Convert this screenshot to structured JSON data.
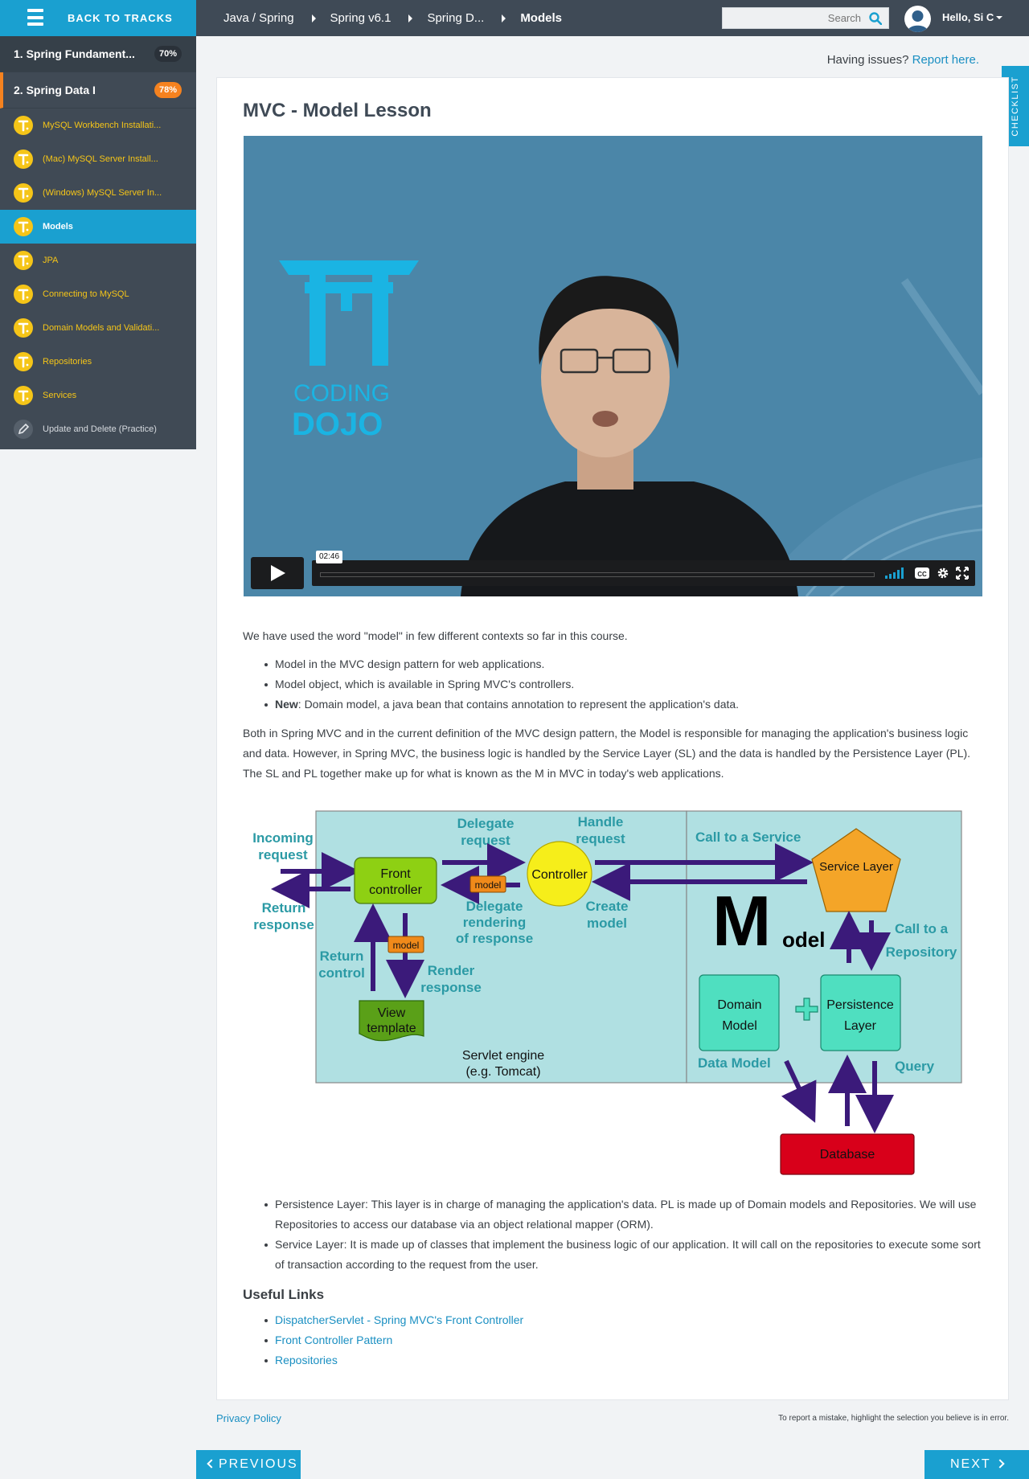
{
  "header": {
    "back_label": "BACK TO TRACKS",
    "breadcrumbs": [
      "Java / Spring",
      "Spring v6.1",
      "Spring D...",
      "Models"
    ],
    "search_placeholder": "Search",
    "user_greeting": "Hello, Si C"
  },
  "sidebar": {
    "sections": [
      {
        "label": "1. Spring Fundament...",
        "progress": "70%"
      },
      {
        "label": "2. Spring Data I",
        "progress": "78%"
      }
    ],
    "lessons": [
      {
        "label": "MySQL Workbench Installati...",
        "icon": "t-badge-icon"
      },
      {
        "label": "(Mac) MySQL Server Install...",
        "icon": "t-badge-icon"
      },
      {
        "label": "(Windows) MySQL Server In...",
        "icon": "t-badge-icon"
      },
      {
        "label": "Models",
        "icon": "t-badge-icon",
        "active": true
      },
      {
        "label": "JPA",
        "icon": "t-badge-icon"
      },
      {
        "label": "Connecting to MySQL",
        "icon": "t-badge-icon"
      },
      {
        "label": "Domain Models and Validati...",
        "icon": "t-badge-icon"
      },
      {
        "label": "Repositories",
        "icon": "t-badge-icon"
      },
      {
        "label": "Services",
        "icon": "t-badge-icon"
      },
      {
        "label": "Update and Delete (Practice)",
        "icon": "pencil-icon"
      }
    ]
  },
  "checklist_label": "CHECKLIST",
  "issues": {
    "text": "Having issues?",
    "link": "Report here."
  },
  "lesson": {
    "title": "MVC - Model Lesson",
    "video": {
      "timecode": "02:46",
      "logo_line1": "CODING",
      "logo_line2": "DOJO"
    },
    "intro": "We have used the word \"model\" in few different contexts so far in this course.",
    "bullets1": [
      {
        "prefix": "",
        "text": "Model in the MVC design pattern for web applications."
      },
      {
        "prefix": "",
        "text": "Model object, which is available in Spring MVC's controllers."
      },
      {
        "prefix": "New",
        "text": ": Domain model, a java bean that contains annotation to represent the application's data."
      }
    ],
    "paragraph": "Both in Spring MVC and in the current definition of the MVC design pattern, the Model is responsible for managing the application's business logic and data. However, in Spring MVC, the business logic is handled by the Service Layer (SL) and the data is handled by the Persistence Layer (PL). The SL and PL together make up for what is known as the M in MVC in today's web applications.",
    "diagram": {
      "incoming_request": [
        "Incoming",
        "request"
      ],
      "return_response": [
        "Return",
        "response"
      ],
      "front_controller": [
        "Front",
        "controller"
      ],
      "delegate_request": [
        "Delegate",
        "request"
      ],
      "controller": "Controller",
      "handle_request": [
        "Handle",
        "request"
      ],
      "model_tag": "model",
      "delegate_rendering": [
        "Delegate",
        "rendering",
        "of response"
      ],
      "create_model": [
        "Create",
        "model"
      ],
      "return_control": [
        "Return",
        "control"
      ],
      "render_response": [
        "Render",
        "response"
      ],
      "view_template": [
        "View",
        "template"
      ],
      "servlet_engine": [
        "Servlet engine",
        "(e.g. Tomcat)"
      ],
      "call_service": "Call to a Service",
      "service_layer": "Service Layer",
      "model_big_m": "M",
      "model_rest": "odel",
      "call_repository": [
        "Call to a",
        "Repository"
      ],
      "domain_model": [
        "Domain",
        "Model"
      ],
      "persistence_layer": [
        "Persistence",
        "Layer"
      ],
      "data_model": "Data Model",
      "query": "Query",
      "database": "Database"
    },
    "bullets2": [
      "Persistence Layer: This layer is in charge of managing the application's data. PL is made up of Domain models and Repositories. We will use Repositories to access our database via an object relational mapper (ORM).",
      "Service Layer: It is made up of classes that implement the business logic of our application. It will call on the repositories to execute some sort of transaction according to the request from the user."
    ],
    "useful_links_heading": "Useful Links",
    "links": [
      "DispatcherServlet - Spring MVC's Front Controller",
      "Front Controller Pattern",
      "Repositories"
    ]
  },
  "footer": {
    "privacy": "Privacy Policy",
    "report_note": "To report a mistake, highlight the selection you believe is in error.",
    "previous": "PREVIOUS",
    "next": "NEXT"
  },
  "colors": {
    "accent": "#1aa0d0",
    "topbar": "#3f4a56",
    "sidebar": "#404a55",
    "progress_orange": "#f5821f",
    "lesson_yellow": "#f5c518",
    "link": "#1a8fc2"
  }
}
